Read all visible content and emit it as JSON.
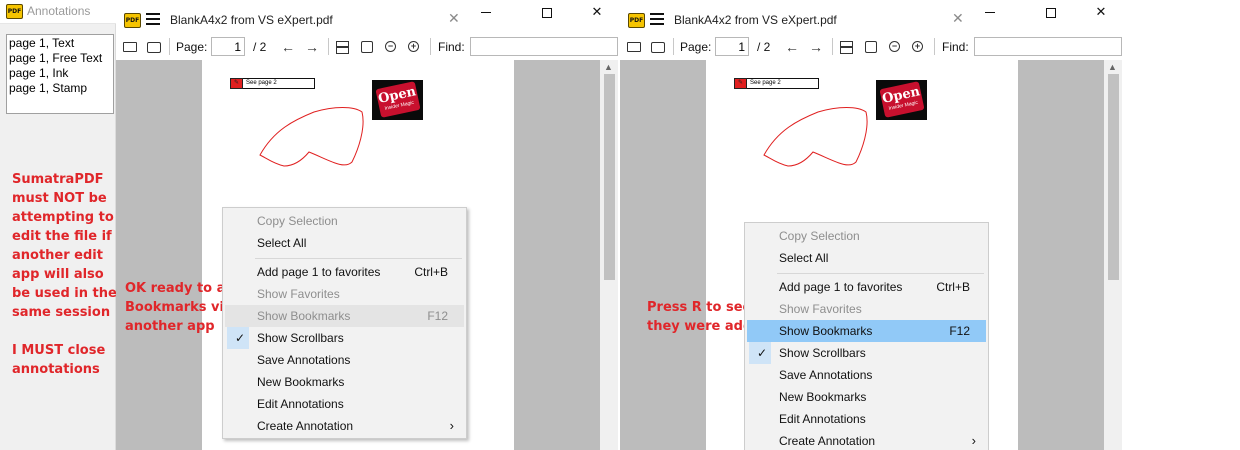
{
  "annotations_panel": {
    "title": "Annotations",
    "items": [
      "page 1, Text",
      "page 1, Free Text",
      "page 1, Ink",
      "page 1, Stamp"
    ]
  },
  "notes": {
    "left": "SumatraPDF\nmust NOT be\nattempting to\nedit the file if\nanother edit\napp will also\nbe used in the\nsame session\n\nI MUST close\nannotations",
    "middle": "OK ready to add\nBookmarks via\nanother app",
    "right": "Press R to see\nthey were added"
  },
  "windows": [
    {
      "tab_title": "BlankA4x2 from VS eXpert.pdf",
      "page_label": "Page:",
      "page_value": "1",
      "page_total": "/ 2",
      "find_label": "Find:",
      "find_value": "",
      "freetext": "See page 2",
      "stamp_main": "Open",
      "stamp_small": "Insider Magic",
      "menu": {
        "copy_selection": "Copy Selection",
        "select_all": "Select All",
        "add_favorites": "Add page 1 to favorites",
        "add_favorites_shortcut": "Ctrl+B",
        "show_favorites": "Show Favorites",
        "show_bookmarks": "Show Bookmarks",
        "show_bookmarks_shortcut": "F12",
        "show_scrollbars": "Show Scrollbars",
        "save_annotations": "Save Annotations",
        "new_bookmarks": "New Bookmarks",
        "edit_annotations": "Edit Annotations",
        "create_annotation": "Create Annotation"
      }
    },
    {
      "tab_title": "BlankA4x2 from VS eXpert.pdf",
      "page_label": "Page:",
      "page_value": "1",
      "page_total": "/ 2",
      "find_label": "Find:",
      "find_value": "",
      "freetext": "See page 2",
      "stamp_main": "Open",
      "stamp_small": "Insider Magic",
      "menu": {
        "copy_selection": "Copy Selection",
        "select_all": "Select All",
        "add_favorites": "Add page 1 to favorites",
        "add_favorites_shortcut": "Ctrl+B",
        "show_favorites": "Show Favorites",
        "show_bookmarks": "Show Bookmarks",
        "show_bookmarks_shortcut": "F12",
        "show_scrollbars": "Show Scrollbars",
        "save_annotations": "Save Annotations",
        "new_bookmarks": "New Bookmarks",
        "edit_annotations": "Edit Annotations",
        "create_annotation": "Create Annotation"
      }
    }
  ],
  "icons": {
    "logo": "PDF",
    "close": "✕",
    "check": "✓",
    "submenu": "›"
  },
  "colors": {
    "note_red": "#e0262a",
    "menu_highlight": "#91c9f7",
    "view_gray": "#bcbcbc",
    "stamp_red": "#c8102e"
  }
}
